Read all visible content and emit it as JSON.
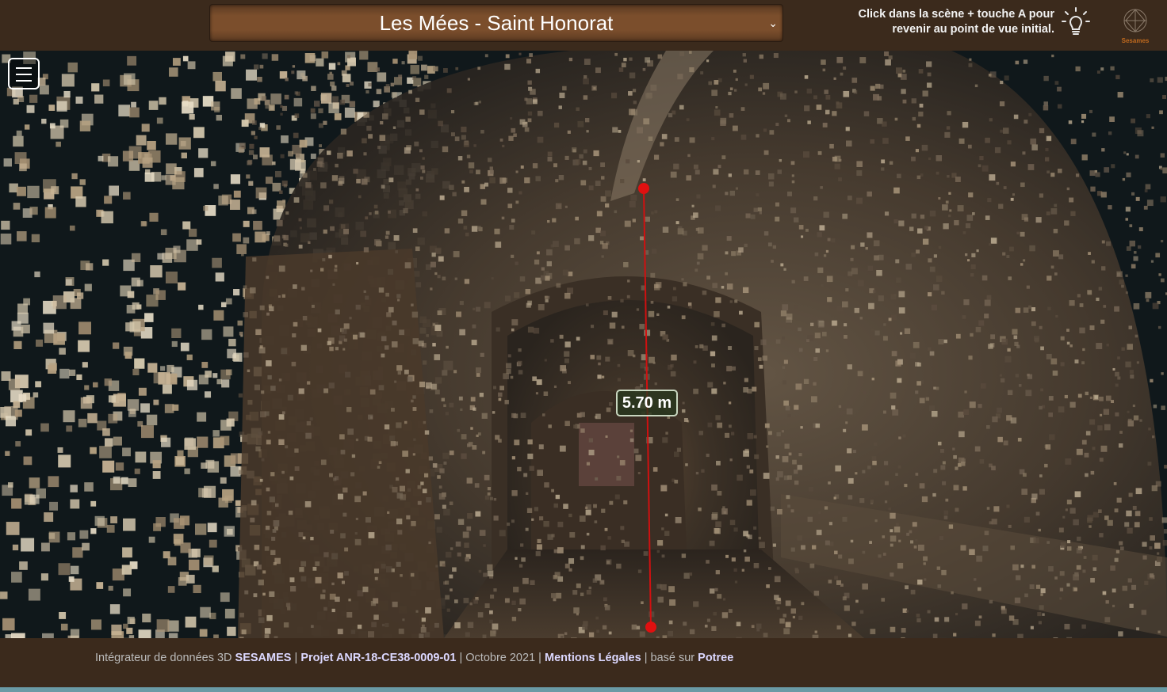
{
  "header": {
    "site_select_value": "Les Mées - Saint Honorat",
    "hint_line1": "Click dans la scène + touche A pour",
    "hint_line2": "revenir au point de vue initial."
  },
  "scene": {
    "measurement_label": "5.70 m"
  },
  "footer": {
    "integrator_text": "Intégrateur de données 3D",
    "sesames_link": "SESAMES",
    "project_link": "Projet ANR-18-CE38-0009-01",
    "date_text": "Octobre 2021",
    "legal_link": "Mentions Légales",
    "based_text": "basé sur",
    "potree_link": "Potree",
    "separator": "|"
  },
  "colors": {
    "header_bg": "#3b2a1c",
    "select_bg": "#7b4e2c",
    "link_color": "#dcd8ff",
    "measure_line": "#d01010",
    "measure_point": "#e01010"
  },
  "icons": {
    "menu": "hamburger-icon",
    "bulb": "lightbulb-icon",
    "logo": "sesames-logo",
    "dropdown": "chevron-down-icon"
  }
}
